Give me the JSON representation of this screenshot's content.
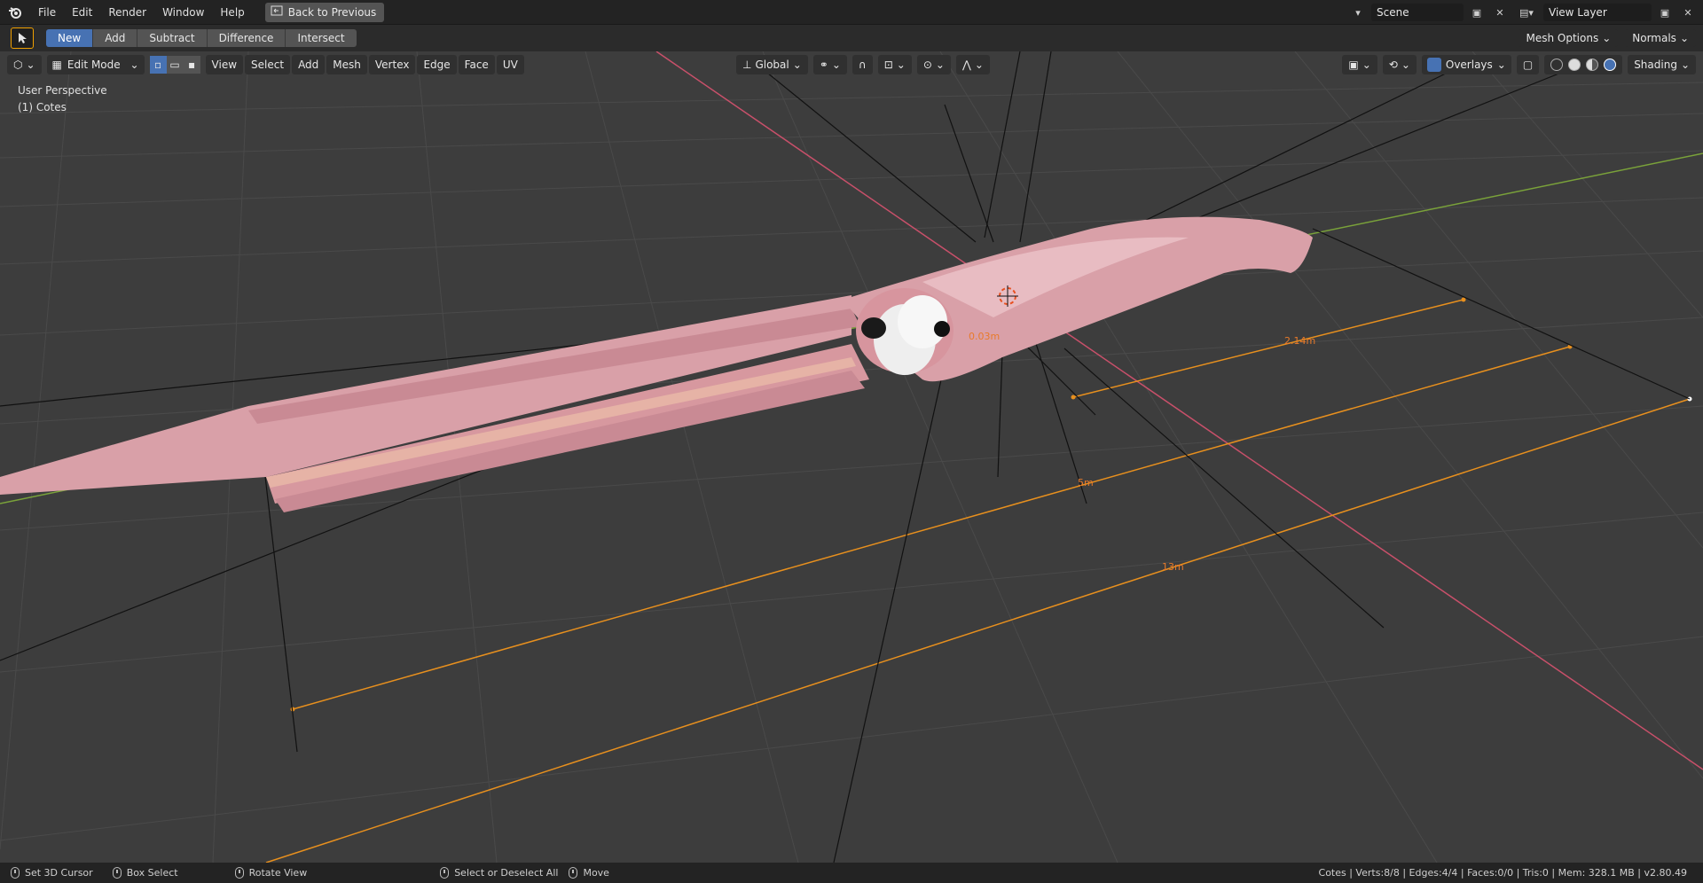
{
  "topbar": {
    "menu": [
      "File",
      "Edit",
      "Render",
      "Window",
      "Help"
    ],
    "back_label": "Back to Previous",
    "scene": "Scene",
    "view_layer": "View Layer"
  },
  "toolheader": {
    "modes": [
      "New",
      "Add",
      "Subtract",
      "Difference",
      "Intersect"
    ],
    "mesh_options": "Mesh Options",
    "normals": "Normals"
  },
  "viewheader": {
    "mode": "Edit Mode",
    "menus": [
      "View",
      "Select",
      "Add",
      "Mesh",
      "Vertex",
      "Edge",
      "Face",
      "UV"
    ],
    "orientation": "Global",
    "overlays": "Overlays",
    "shading": "Shading"
  },
  "viewport": {
    "perspective": "User Perspective",
    "object": "(1) Cotes",
    "measurements": [
      "2.14m",
      "5m",
      "13m",
      "0.03m"
    ]
  },
  "statusbar": {
    "items": [
      "Set 3D Cursor",
      "Box Select",
      "Rotate View",
      "Select or Deselect All",
      "Move"
    ],
    "stats": "Cotes | Verts:8/8 | Edges:4/4 | Faces:0/0 | Tris:0 | Mem: 328.1 MB | v2.80.49"
  },
  "colors": {
    "accent": "#4772b3",
    "axis_x": "#c8506a",
    "axis_y": "#7aa23a",
    "selection": "#e8901e",
    "mesh": "#d9a0a8"
  }
}
